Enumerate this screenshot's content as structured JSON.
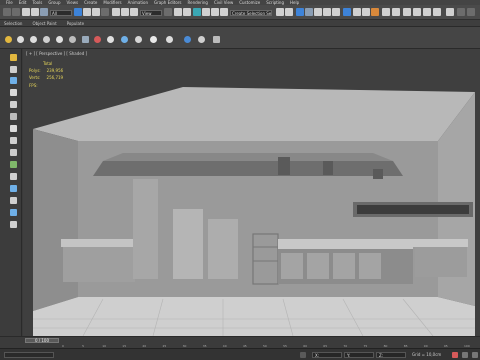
{
  "menu": [
    "File",
    "Edit",
    "Tools",
    "Group",
    "Views",
    "Create",
    "Modifiers",
    "Animation",
    "Graph Editors",
    "Rendering",
    "Civil View",
    "Customize",
    "Scripting",
    "Help"
  ],
  "toolbar": {
    "selection_filter": "All",
    "view_dropdown": "View",
    "named_selection": "Create Selection Se"
  },
  "ribbon": {
    "tabs": [
      "Selection",
      "Object Paint",
      "Populate"
    ]
  },
  "viewport": {
    "label": "[ + ] [ Perspective ] [ Shaded ]",
    "stats": {
      "heading": "Total",
      "polys_label": "Polys:",
      "polys_value": "239,956",
      "verts_label": "Verts:",
      "verts_value": "256,719"
    },
    "fps_label": "FPS:"
  },
  "timeline": {
    "slider_text": "0 / 100",
    "ticks": [
      "0",
      "5",
      "10",
      "15",
      "20",
      "25",
      "30",
      "35",
      "40",
      "45",
      "50",
      "55",
      "60",
      "65",
      "70",
      "75",
      "80",
      "85",
      "90",
      "95",
      "100"
    ]
  },
  "status": {
    "x": "X:",
    "y": "Y:",
    "z": "Z:",
    "grid": "Grid = 10,0cm"
  },
  "colors": {
    "accent": "#3d83d9",
    "stats_text": "#e8d75a",
    "scene_wall": "#9a9a9a",
    "scene_floor": "#cfcfcf"
  }
}
